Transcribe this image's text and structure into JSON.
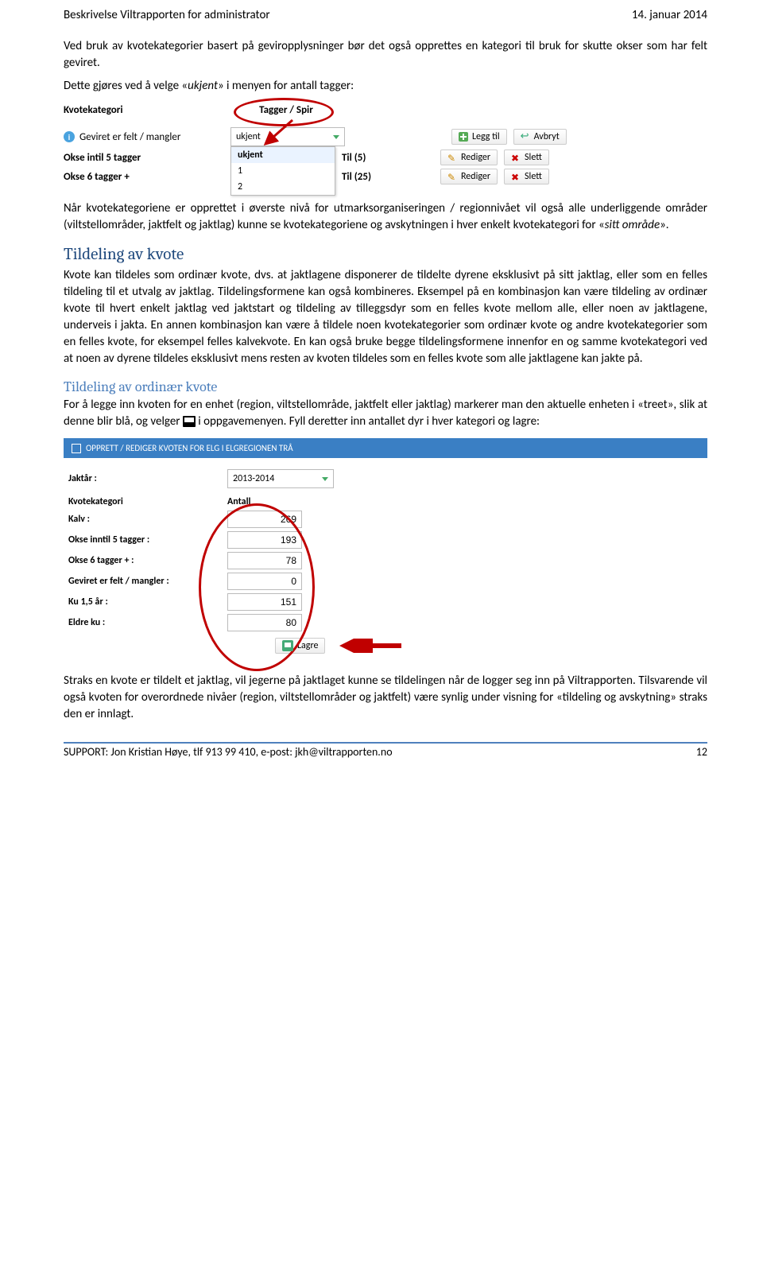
{
  "header": {
    "left": "Beskrivelse Viltrapporten for administrator",
    "right": "14. januar 2014"
  },
  "intro": {
    "p1": "Ved bruk av kvotekategorier basert på geviropplysninger bør det også opprettes en kategori til bruk for skutte okser som har felt geviret.",
    "p2_a": "Dette gjøres ved å velge «",
    "p2_i": "ukjent",
    "p2_b": "» i menyen for antall tagger:"
  },
  "s1": {
    "h_cat": "Kvotekategori",
    "h_tag": "Tagger / Spir",
    "row1_label": "Geviret er felt / mangler",
    "dd_value": "ukjent",
    "dd_opts": {
      "o0": "ukjent",
      "o1": "1",
      "o2": "2"
    },
    "row2_label": "Okse intil 5 tagger",
    "row2_spir": "Til (5)",
    "row3_label": "Okse 6 tagger +",
    "row3_spir": "Til (25)",
    "btn_add": "Legg til",
    "btn_cancel": "Avbryt",
    "btn_edit": "Rediger",
    "btn_del": "Slett"
  },
  "mid": {
    "p3_a": "Når kvotekategoriene er opprettet i øverste nivå for utmarksorganiseringen / regionnivået vil også alle underliggende områder (viltstellområder, jaktfelt og jaktlag) kunne se kvotekategoriene og avskytningen i hver enkelt kvotekategori for «",
    "p3_i": "sitt område",
    "p3_b": "»."
  },
  "sec1": {
    "h2": "Tildeling av kvote",
    "p4": "Kvote kan tildeles som ordinær kvote, dvs. at jaktlagene disponerer de tildelte dyrene eksklusivt på sitt jaktlag, eller som en felles tildeling til et utvalg av jaktlag. Tildelingsformene kan også kombineres. Eksempel på en kombinasjon kan være tildeling av ordinær kvote til hvert enkelt jaktlag ved jaktstart og tildeling av tilleggsdyr som en felles kvote mellom alle, eller noen av jaktlagene, underveis i jakta. En annen kombinasjon kan være å tildele noen kvotekategorier som ordinær kvote og andre kvotekategorier som en felles kvote, for eksempel felles kalvekvote. En kan også bruke begge tildelingsformene innenfor en og samme kvotekategori ved at noen av dyrene tildeles eksklusivt mens resten av kvoten tildeles som en felles kvote som alle jaktlagene kan jakte på."
  },
  "sec2": {
    "h3": "Tildeling av ordinær kvote",
    "p5a": "For å legge inn kvoten for en enhet (region, viltstellområde, jaktfelt eller jaktlag) markerer man den aktuelle enheten i «treet», slik at denne blir blå, og velger ",
    "p5b": " i oppgavemenyen. Fyll deretter inn antallet dyr i hver kategori og lagre:"
  },
  "s2": {
    "title": "OPPRETT / REDIGER KVOTEN FOR ELG I ELGREGIONEN TRÅ",
    "jaktaar_k": "Jaktår :",
    "jaktaar_v": "2013-2014",
    "h_cat": "Kvotekategori",
    "h_ant": "Antall",
    "rows": {
      "r0k": "Kalv :",
      "r0v": "269",
      "r1k": "Okse inntil 5 tagger :",
      "r1v": "193",
      "r2k": "Okse 6 tagger + :",
      "r2v": "78",
      "r3k": "Geviret er felt / mangler :",
      "r3v": "0",
      "r4k": "Ku 1,5 år :",
      "r4v": "151",
      "r5k": "Eldre ku :",
      "r5v": "80"
    },
    "btn_save": "Lagre"
  },
  "outro": {
    "p6": "Straks en kvote er tildelt et jaktlag, vil jegerne på jaktlaget kunne se tildelingen når de logger seg inn på Viltrapporten. Tilsvarende vil også kvoten for overordnede nivåer (region, viltstellområder og jaktfelt) være synlig under visning for «tildeling og avskytning» straks den er innlagt."
  },
  "footer": {
    "left": "SUPPORT: Jon Kristian Høye,  tlf 913 99 410,  e-post: jkh@viltrapporten.no",
    "right": "12"
  }
}
